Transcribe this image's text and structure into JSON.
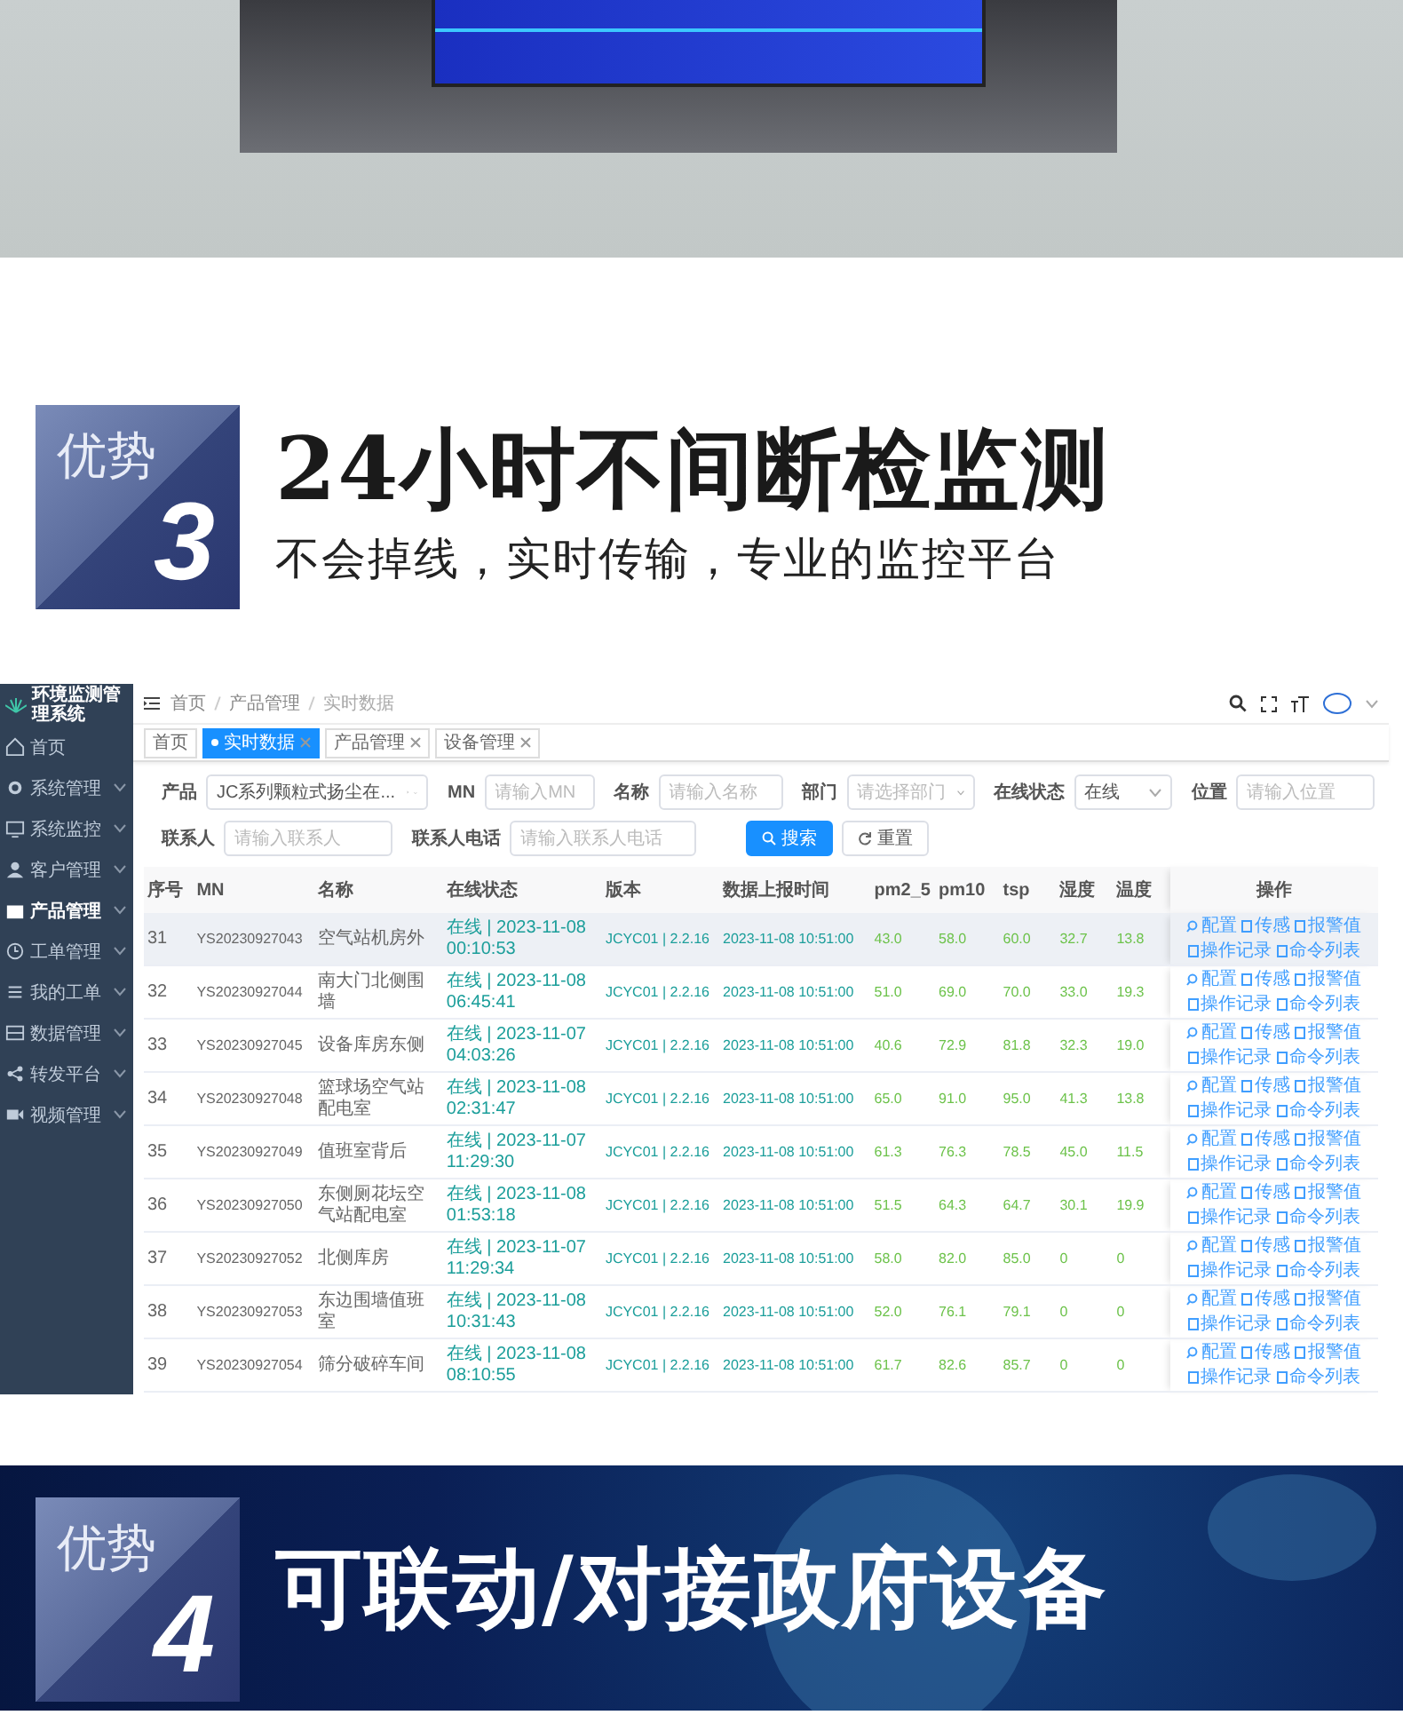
{
  "advantage_3": {
    "badge_label": "优势",
    "badge_number": "3",
    "title": "24小时不间断检监测",
    "subtitle": "不会掉线，实时传输，专业的监控平台"
  },
  "screenshot": {
    "sidebar": {
      "title": "环境监测管理系统",
      "items": [
        {
          "label": "首页",
          "kind": "link",
          "selected": false
        },
        {
          "label": "系统管理",
          "kind": "group",
          "selected": false
        },
        {
          "label": "系统监控",
          "kind": "group",
          "selected": false
        },
        {
          "label": "客户管理",
          "kind": "group",
          "selected": false
        },
        {
          "label": "产品管理",
          "kind": "group",
          "selected": true
        },
        {
          "label": "工单管理",
          "kind": "group",
          "selected": false
        },
        {
          "label": "我的工单",
          "kind": "group",
          "selected": false
        },
        {
          "label": "数据管理",
          "kind": "group",
          "selected": false
        },
        {
          "label": "转发平台",
          "kind": "group",
          "selected": false
        },
        {
          "label": "视频管理",
          "kind": "group",
          "selected": false
        }
      ]
    },
    "breadcrumbs": [
      "首页",
      "产品管理",
      "实时数据"
    ],
    "tabs": [
      {
        "label": "首页",
        "selected": false,
        "closable": false
      },
      {
        "label": "实时数据",
        "selected": true,
        "closable": true
      },
      {
        "label": "产品管理",
        "selected": false,
        "closable": true
      },
      {
        "label": "设备管理",
        "selected": false,
        "closable": true
      }
    ],
    "filter_rows": [
      [
        {
          "label": "产品",
          "kind": "select",
          "value": "JC系列颗粒式扬尘在...",
          "clearable": true
        },
        {
          "label": "MN",
          "kind": "input",
          "placeholder": "请输入MN"
        },
        {
          "label": "名称",
          "kind": "input",
          "placeholder": "请输入名称"
        },
        {
          "label": "部门",
          "kind": "select",
          "placeholder": "请选择部门",
          "clearable": false
        },
        {
          "label": "在线状态",
          "kind": "select",
          "value": "在线",
          "clearable": false
        },
        {
          "label": "位置",
          "kind": "input",
          "placeholder": "请输入位置"
        }
      ],
      [
        {
          "label": "联系人",
          "kind": "input",
          "placeholder": "请输入联系人"
        },
        {
          "label": "联系人电话",
          "kind": "input",
          "placeholder": "请输入联系人电话"
        }
      ]
    ],
    "buttons": [
      {
        "label": "搜索",
        "kind": "primary"
      },
      {
        "label": "重置",
        "kind": "default"
      }
    ],
    "table": {
      "columns": [
        "序号",
        "MN",
        "名称",
        "在线状态",
        "版本",
        "数据上报时间",
        "pm2_5",
        "pm10",
        "tsp",
        "湿度",
        "温度",
        "操作"
      ],
      "rows": [
        {
          "selected": true,
          "cells": [
            "31",
            "YS20230927043",
            "空气站机房外",
            "在线 | 2023-11-08 00:10:53",
            "JCYC01 | 2.2.16",
            "2023-11-08 10:51:00",
            "43.0",
            "58.0",
            "60.0",
            "32.7",
            "13.8"
          ],
          "actions": [
            "配置",
            "传感",
            "报警值",
            "操作记录",
            "命令列表"
          ]
        },
        {
          "selected": false,
          "cells": [
            "32",
            "YS20230927044",
            "南大门北侧围墙",
            "在线 | 2023-11-08 06:45:41",
            "JCYC01 | 2.2.16",
            "2023-11-08 10:51:00",
            "51.0",
            "69.0",
            "70.0",
            "33.0",
            "19.3"
          ],
          "actions": [
            "配置",
            "传感",
            "报警值",
            "操作记录",
            "命令列表"
          ]
        },
        {
          "selected": false,
          "cells": [
            "33",
            "YS20230927045",
            "设备库房东侧",
            "在线 | 2023-11-07 04:03:26",
            "JCYC01 | 2.2.16",
            "2023-11-08 10:51:00",
            "40.6",
            "72.9",
            "81.8",
            "32.3",
            "19.0"
          ],
          "actions": [
            "配置",
            "传感",
            "报警值",
            "操作记录",
            "命令列表"
          ]
        },
        {
          "selected": false,
          "cells": [
            "34",
            "YS20230927048",
            "篮球场空气站配电室",
            "在线 | 2023-11-08 02:31:47",
            "JCYC01 | 2.2.16",
            "2023-11-08 10:51:00",
            "65.0",
            "91.0",
            "95.0",
            "41.3",
            "13.8"
          ],
          "actions": [
            "配置",
            "传感",
            "报警值",
            "操作记录",
            "命令列表"
          ]
        },
        {
          "selected": false,
          "cells": [
            "35",
            "YS20230927049",
            "值班室背后",
            "在线 | 2023-11-07 11:29:30",
            "JCYC01 | 2.2.16",
            "2023-11-08 10:51:00",
            "61.3",
            "76.3",
            "78.5",
            "45.0",
            "11.5"
          ],
          "actions": [
            "配置",
            "传感",
            "报警值",
            "操作记录",
            "命令列表"
          ]
        },
        {
          "selected": false,
          "cells": [
            "36",
            "YS20230927050",
            "东侧厕花坛空气站配电室",
            "在线 | 2023-11-08 01:53:18",
            "JCYC01 | 2.2.16",
            "2023-11-08 10:51:00",
            "51.5",
            "64.3",
            "64.7",
            "30.1",
            "19.9"
          ],
          "actions": [
            "配置",
            "传感",
            "报警值",
            "操作记录",
            "命令列表"
          ]
        },
        {
          "selected": false,
          "cells": [
            "37",
            "YS20230927052",
            "北侧库房",
            "在线 | 2023-11-07 11:29:34",
            "JCYC01 | 2.2.16",
            "2023-11-08 10:51:00",
            "58.0",
            "82.0",
            "85.0",
            "0",
            "0"
          ],
          "actions": [
            "配置",
            "传感",
            "报警值",
            "操作记录",
            "命令列表"
          ]
        },
        {
          "selected": false,
          "cells": [
            "38",
            "YS20230927053",
            "东边围墙值班室",
            "在线 | 2023-11-08 10:31:43",
            "JCYC01 | 2.2.16",
            "2023-11-08 10:51:00",
            "52.0",
            "76.1",
            "79.1",
            "0",
            "0"
          ],
          "actions": [
            "配置",
            "传感",
            "报警值",
            "操作记录",
            "命令列表"
          ]
        },
        {
          "selected": false,
          "cells": [
            "39",
            "YS20230927054",
            "筛分破碎车间",
            "在线 | 2023-11-08 08:10:55",
            "JCYC01 | 2.2.16",
            "2023-11-08 10:51:00",
            "61.7",
            "82.6",
            "85.7",
            "0",
            "0"
          ],
          "actions": [
            "配置",
            "传感",
            "报警值",
            "操作记录",
            "命令列表"
          ]
        }
      ]
    }
  },
  "advantage_4": {
    "badge_label": "优势",
    "badge_number": "4",
    "title": "可联动/对接政府设备"
  }
}
